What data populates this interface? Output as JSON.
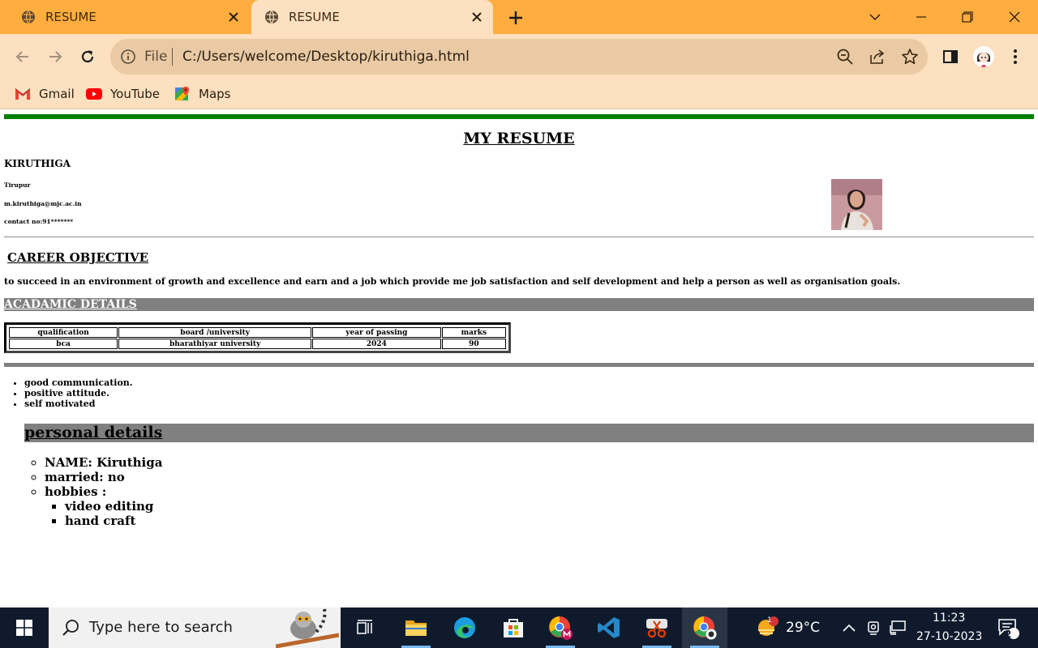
{
  "browser": {
    "tabs": [
      {
        "title": "RESUME",
        "active": false
      },
      {
        "title": "RESUME",
        "active": true
      }
    ],
    "address": {
      "scheme_label": "File",
      "url": "C:/Users/welcome/Desktop/kiruthiga.html"
    },
    "bookmarks": [
      {
        "label": "Gmail",
        "icon": "gmail-icon"
      },
      {
        "label": "YouTube",
        "icon": "youtube-icon"
      },
      {
        "label": "Maps",
        "icon": "maps-icon"
      }
    ],
    "colors": {
      "frame": "#ffad3f",
      "toolbar": "#fce0bf"
    }
  },
  "resume": {
    "title": "MY RESUME",
    "name": "KIRUTHIGA",
    "city": "Tirupur",
    "email": "m.kiruthiga@mjc.ac.in",
    "contact": "contact no:91*******",
    "career_heading": "CAREER OBJECTIVE",
    "career_text": "to succeed in an environment of growth and excellence and earn and a job which provide me job satisfaction and self development and help a person as well as organisation goals.",
    "academic_heading": "ACADAMIC DETAILS",
    "table": {
      "headers": [
        "qualification",
        "board /university",
        "year of passing",
        "marks"
      ],
      "rows": [
        [
          "bca",
          "bharathiyar university",
          "2024",
          "90"
        ]
      ]
    },
    "skills": [
      "good communication.",
      "positive attitude.",
      "self motivated"
    ],
    "personal_heading": "personal details",
    "personal": {
      "name": "NAME: Kiruthiga",
      "married": "married: no",
      "hobbies_label": "hobbies :",
      "hobbies": [
        "video editing",
        "hand craft"
      ]
    },
    "colors": {
      "rule": "#008000",
      "band": "#808080"
    }
  },
  "taskbar": {
    "search_placeholder": "Type here to search",
    "weather": {
      "temp": "29°C",
      "badge": "1"
    },
    "clock": {
      "time": "11:23",
      "date": "27-10-2023"
    },
    "notifications": "2"
  }
}
